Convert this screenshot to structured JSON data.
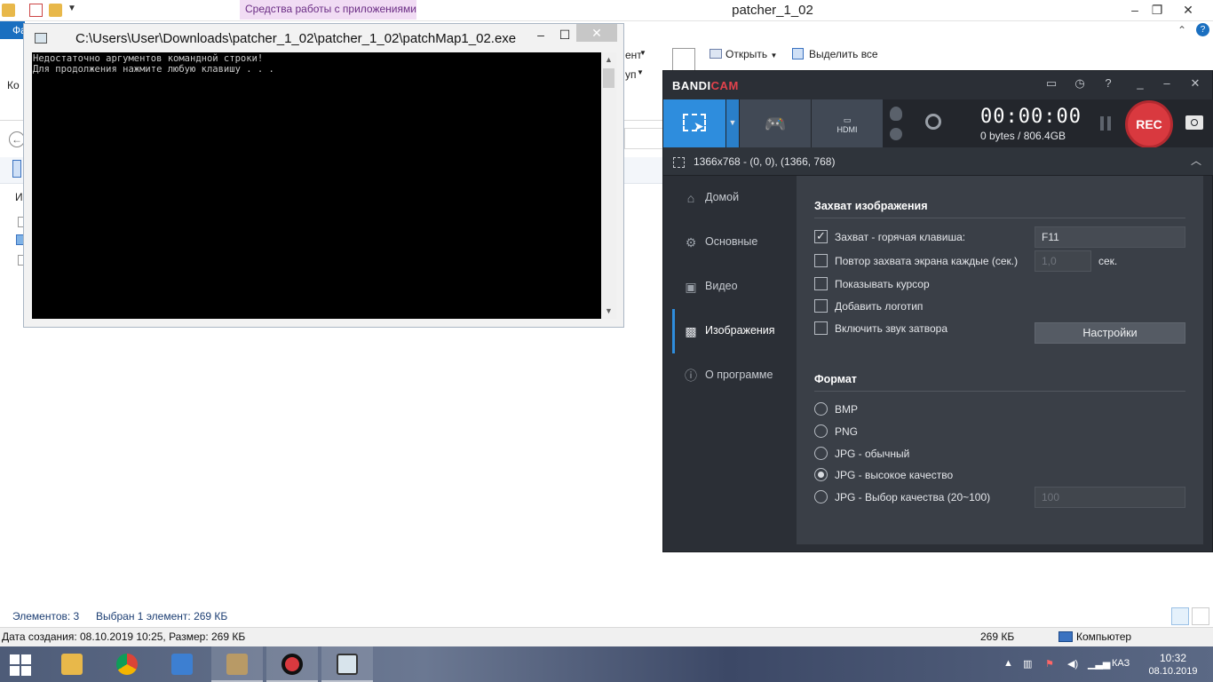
{
  "explorer": {
    "title": "patcher_1_02",
    "tool_tab": "Средства работы с приложениями",
    "file_tab": "Фа",
    "ribbon": {
      "open_label": "Открыть",
      "select_all_label": "Выделить все",
      "copy_partial": "Ко",
      "group_partial": "уп",
      "group_partial2": "ент"
    },
    "left_partial": "И",
    "status": {
      "items_count": "Элементов: 3",
      "selected": "Выбран 1 элемент: 269 КБ"
    },
    "details": {
      "created": "Дата создания: 08.10.2019 10:25, Размер: 269 КБ",
      "size": "269 КБ",
      "location": "Компьютер"
    }
  },
  "console": {
    "title": "C:\\Users\\User\\Downloads\\patcher_1_02\\patcher_1_02\\patchMap1_02.exe",
    "lines": [
      "Недостаточно аргументов командной строки!",
      "Для продолжения нажмите любую клавишу . . ."
    ]
  },
  "bandicam": {
    "logo_main": "BANDI",
    "logo_accent": "CAM",
    "timer": "00:00:00",
    "bytes": "0 bytes / 806.4GB",
    "rec_label": "REC",
    "region": "1366x768 - (0, 0), (1366, 768)",
    "sidebar": [
      {
        "label": "Домой",
        "icon": "home-icon"
      },
      {
        "label": "Основные",
        "icon": "gear-icon"
      },
      {
        "label": "Видео",
        "icon": "video-icon"
      },
      {
        "label": "Изображения",
        "icon": "image-settings-icon"
      },
      {
        "label": "О программе",
        "icon": "info-icon"
      }
    ],
    "active_sidebar": "Изображения",
    "capture": {
      "title": "Захват изображения",
      "hotkey_label": "Захват - горячая клавиша:",
      "hotkey_value": "F11",
      "repeat_label": "Повтор захвата экрана каждые (сек.)",
      "repeat_value": "1,0",
      "repeat_unit": "сек.",
      "cursor_label": "Показывать курсор",
      "logo_label": "Добавить логотип",
      "shutter_label": "Включить звук затвора",
      "settings_button": "Настройки"
    },
    "format": {
      "title": "Формат",
      "options": [
        "BMP",
        "PNG",
        "JPG - обычный",
        "JPG - высокое качество",
        "JPG - Выбор качества (20~100)"
      ],
      "selected": "JPG - высокое качество",
      "quality_value": "100"
    }
  },
  "taskbar": {
    "language": "КАЗ",
    "time": "10:32",
    "date": "08.10.2019"
  },
  "colors": {
    "accent": "#2e8ddd",
    "rec": "#d9393f",
    "tool_tab": "#f1dcf4"
  }
}
